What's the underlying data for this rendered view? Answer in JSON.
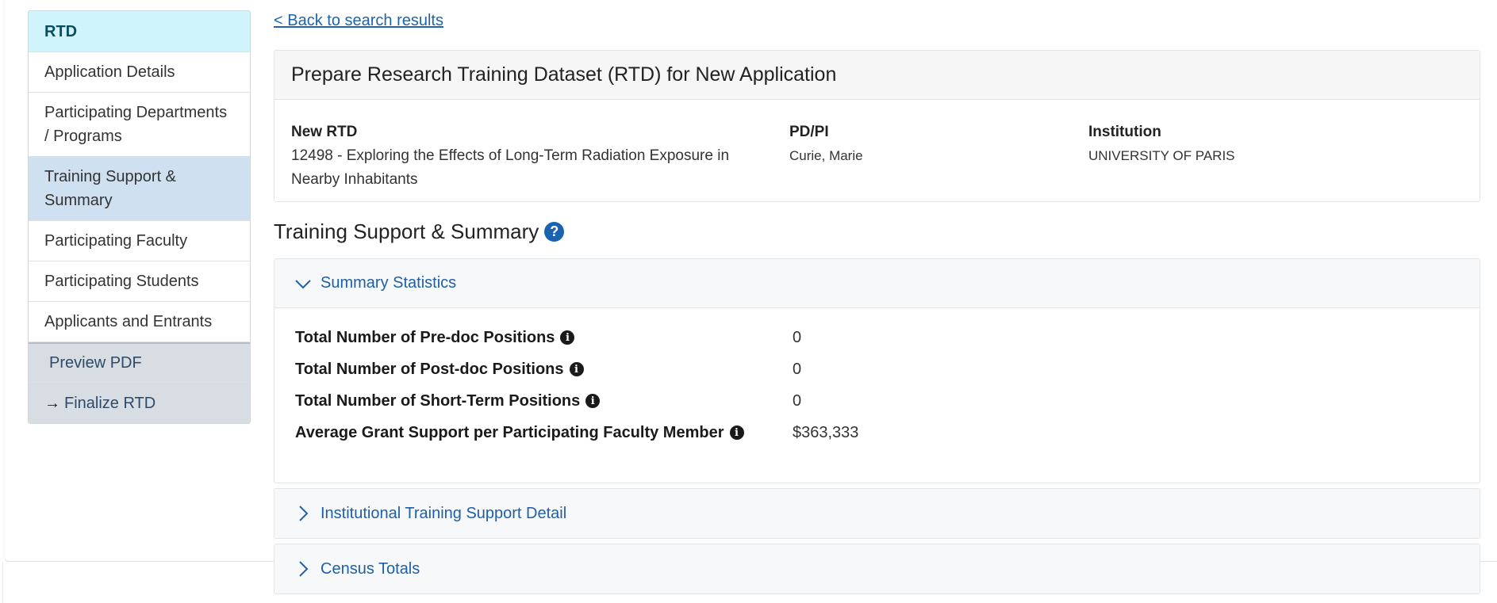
{
  "sidebar": {
    "header": "RTD",
    "items": [
      {
        "label": "Application Details"
      },
      {
        "label": "Participating Departments / Programs"
      },
      {
        "label": "Training Support & Summary"
      },
      {
        "label": "Participating Faculty"
      },
      {
        "label": "Participating Students"
      },
      {
        "label": "Applicants and Entrants"
      }
    ],
    "actions": [
      {
        "label": "Preview PDF"
      },
      {
        "label": "Finalize RTD",
        "icon": "arrow-right-icon"
      }
    ]
  },
  "back_link": "< Back to search results",
  "header_card": {
    "title": "Prepare Research Training Dataset (RTD) for New Application",
    "fields": [
      {
        "label": "New RTD",
        "value": "12498 - Exploring the Effects of Long-Term Radiation Exposure in Nearby Inhabitants"
      },
      {
        "label": "PD/PI",
        "value": "Curie, Marie"
      },
      {
        "label": "Institution",
        "value": "UNIVERSITY OF PARIS"
      }
    ]
  },
  "section": {
    "title": "Training Support & Summary",
    "help_icon": "?"
  },
  "accordions": [
    {
      "title": "Summary Statistics",
      "expanded": true,
      "rows": [
        {
          "label": "Total Number of Pre-doc Positions",
          "value": "0"
        },
        {
          "label": "Total Number of Post-doc Positions",
          "value": "0"
        },
        {
          "label": "Total Number of Short-Term Positions",
          "value": "0"
        },
        {
          "label": "Average Grant Support per Participating Faculty Member",
          "value": "$363,333"
        }
      ]
    },
    {
      "title": "Institutional Training Support Detail",
      "expanded": false
    },
    {
      "title": "Census Totals",
      "expanded": false
    }
  ],
  "info_icon_glyph": "i",
  "colors": {
    "link": "#1f63ad",
    "sidebar_header_bg": "#cff4fc",
    "sidebar_active_bg": "#cfe0f0",
    "help_icon": "#1b63b0"
  }
}
